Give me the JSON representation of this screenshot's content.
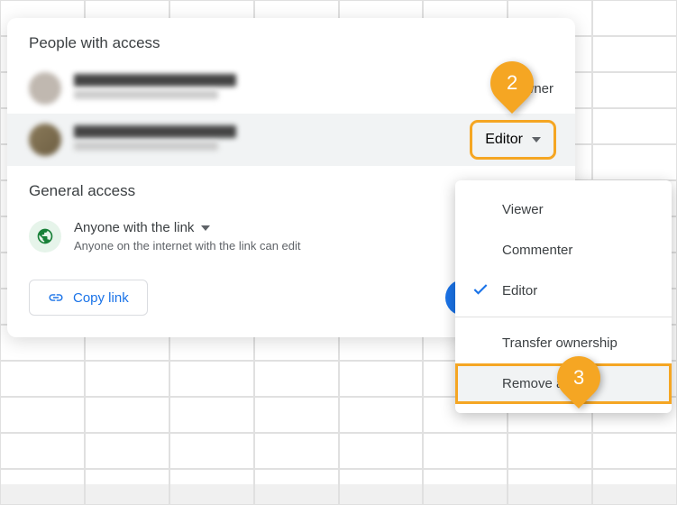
{
  "sections": {
    "people": "People with access",
    "general": "General access"
  },
  "users": [
    {
      "role": "Owner"
    },
    {
      "role": "Editor"
    }
  ],
  "general_access": {
    "title": "Anyone with the link",
    "subtitle": "Anyone on the internet with the link can edit"
  },
  "buttons": {
    "copy_link": "Copy link"
  },
  "dropdown": {
    "items": [
      {
        "label": "Viewer",
        "checked": false
      },
      {
        "label": "Commenter",
        "checked": false
      },
      {
        "label": "Editor",
        "checked": true
      }
    ],
    "extra": [
      {
        "label": "Transfer ownership"
      },
      {
        "label": "Remove access"
      }
    ]
  },
  "callouts": {
    "c2": "2",
    "c3": "3"
  }
}
